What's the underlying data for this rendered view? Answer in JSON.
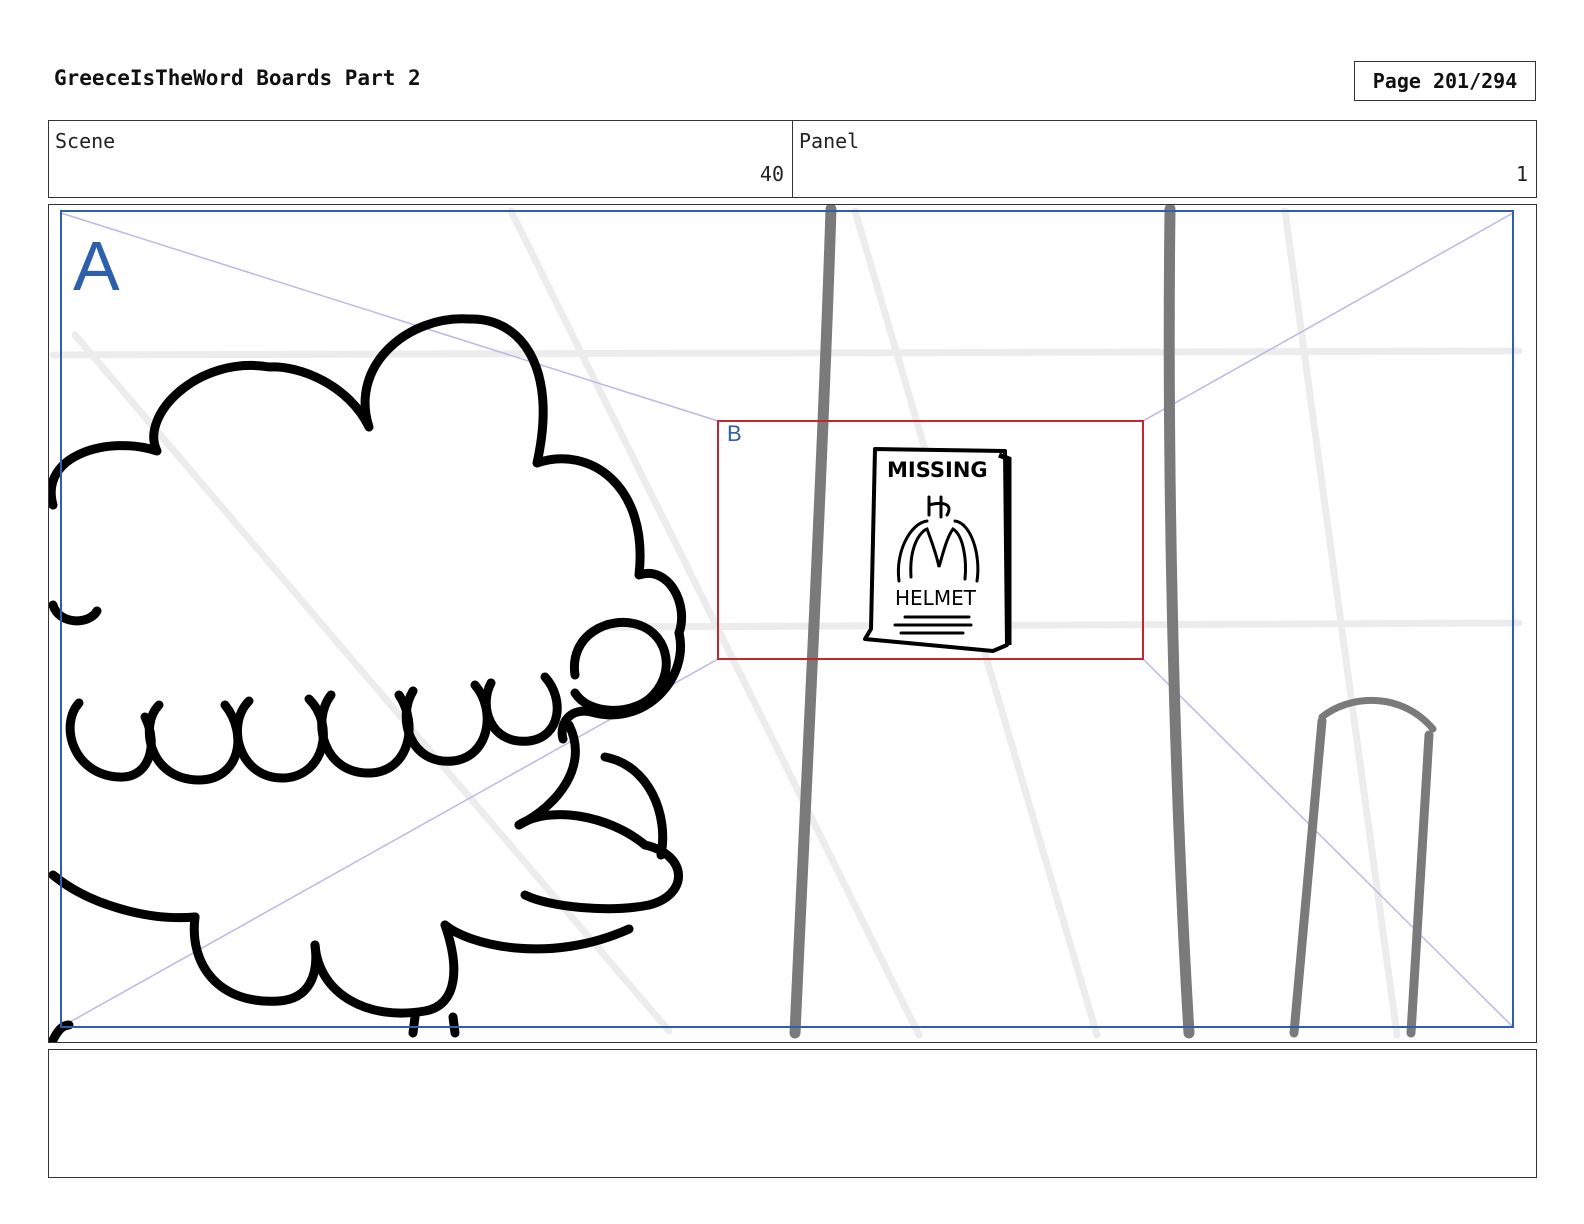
{
  "header": {
    "title": "GreeceIsTheWord Boards Part 2",
    "page_label": "Page 201/294"
  },
  "info": {
    "scene_label": "Scene",
    "scene_value": "40",
    "panel_label": "Panel",
    "panel_value": "1"
  },
  "panel": {
    "frame_a_label": "A",
    "frame_b_label": "B",
    "poster_text_top": "MISSING",
    "poster_text_bottom": "HELMET",
    "colors": {
      "frame_a": "#2d5fad",
      "frame_b": "#c0282d",
      "guides": "#b9b9e8"
    }
  },
  "notes": {
    "text": ""
  }
}
